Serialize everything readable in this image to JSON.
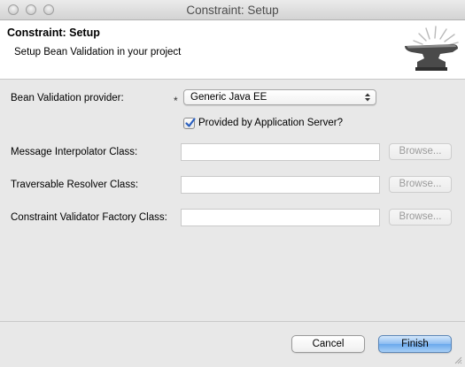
{
  "window": {
    "title": "Constraint: Setup"
  },
  "header": {
    "title": "Constraint: Setup",
    "description": "Setup Bean Validation in your project",
    "icon": "anvil-icon"
  },
  "form": {
    "provider": {
      "label": "Bean Validation provider:",
      "required_mark": "*",
      "value": "Generic Java EE"
    },
    "app_server": {
      "label": "Provided by Application Server?",
      "checked": true
    },
    "rows": [
      {
        "label": "Message Interpolator Class:",
        "value": "",
        "button": "Browse..."
      },
      {
        "label": "Traversable Resolver Class:",
        "value": "",
        "button": "Browse..."
      },
      {
        "label": "Constraint Validator Factory Class:",
        "value": "",
        "button": "Browse..."
      }
    ]
  },
  "footer": {
    "cancel": "Cancel",
    "finish": "Finish"
  },
  "colors": {
    "accent": "#6aa8ec",
    "checkmark": "#2a5fbf",
    "disabled_text": "#9a9a9a"
  }
}
